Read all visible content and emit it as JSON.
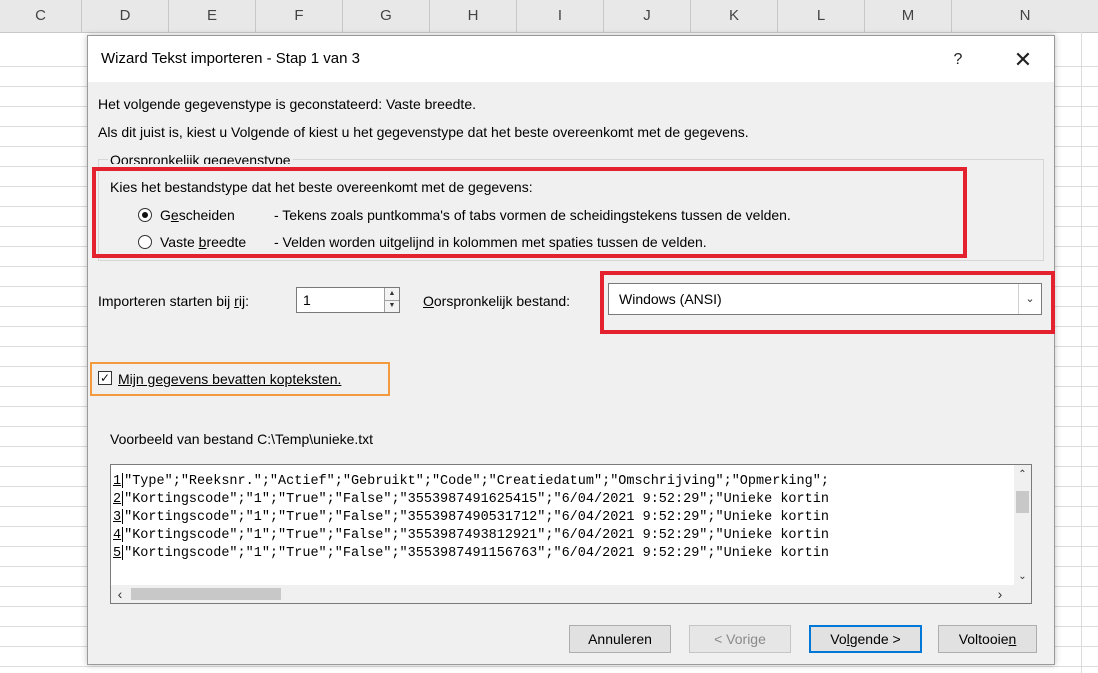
{
  "spreadsheet": {
    "columns": [
      "C",
      "D",
      "E",
      "F",
      "G",
      "H",
      "I",
      "J",
      "K",
      "L",
      "M",
      "N"
    ]
  },
  "dialog": {
    "title": "Wizard Tekst importeren - Stap 1 van 3",
    "help_label": "?",
    "close_label": "✕",
    "detected_line": "Het volgende gegevenstype is geconstateerd: Vaste breedte.",
    "instruction_line": "Als dit juist is, kiest u Volgende of kiest u het gegevenstype dat het beste overeenkomt met de gegevens.",
    "group_title": "Oorspronkelijk gegevenstype",
    "group_prompt": "Kies het bestandstype dat het beste overeenkomt met de gegevens:",
    "radio_options": [
      {
        "label_pre": "G",
        "label_u": "e",
        "label_post": "scheiden",
        "desc": "- Tekens zoals puntkomma's of tabs vormen de scheidingstekens tussen de velden.",
        "selected": true
      },
      {
        "label_pre": "Vaste ",
        "label_u": "b",
        "label_post": "reedte",
        "desc": "- Velden worden uitgelijnd in kolommen met spaties tussen de velden.",
        "selected": false
      }
    ],
    "start_row_label_pre": "Importeren starten bij ",
    "start_row_label_u": "r",
    "start_row_label_post": "ij:",
    "start_row_value": "1",
    "origin_label_u": "O",
    "origin_label_post": "orspronkelijk bestand:",
    "origin_value": "Windows (ANSI)",
    "headers_checkbox_label": "Mijn gegevens bevatten kopteksten.",
    "headers_checked": true,
    "preview_label": "Voorbeeld van bestand C:\\Temp\\unieke.txt",
    "preview_rows": [
      {
        "num": "1",
        "text": "\"Type\";\"Reeksnr.\";\"Actief\";\"Gebruikt\";\"Code\";\"Creatiedatum\";\"Omschrijving\";\"Opmerking\";"
      },
      {
        "num": "2",
        "text": "\"Kortingscode\";\"1\";\"True\";\"False\";\"3553987491625415\";\"6/04/2021 9:52:29\";\"Unieke kortin"
      },
      {
        "num": "3",
        "text": "\"Kortingscode\";\"1\";\"True\";\"False\";\"3553987490531712\";\"6/04/2021 9:52:29\";\"Unieke kortin"
      },
      {
        "num": "4",
        "text": "\"Kortingscode\";\"1\";\"True\";\"False\";\"3553987493812921\";\"6/04/2021 9:52:29\";\"Unieke kortin"
      },
      {
        "num": "5",
        "text": "\"Kortingscode\";\"1\";\"True\";\"False\";\"3553987491156763\";\"6/04/2021 9:52:29\";\"Unieke kortin"
      }
    ],
    "buttons": {
      "cancel": "Annuleren",
      "back": "< Vorige",
      "next_pre": "Vo",
      "next_u": "l",
      "next_post": "gende >",
      "finish_pre": "Voltooie",
      "finish_u": "n",
      "finish_post": ""
    }
  },
  "highlight_colors": {
    "red": "#e3212f",
    "orange": "#f39a3e"
  }
}
